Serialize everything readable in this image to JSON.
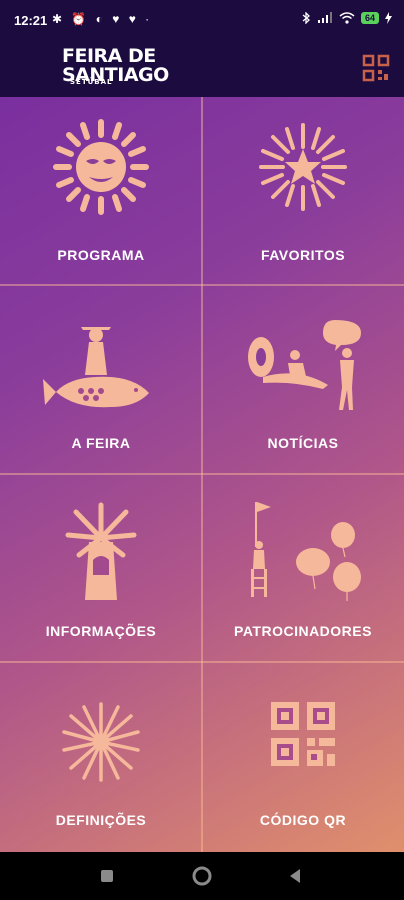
{
  "status_bar": {
    "time": "12:21",
    "left_icons": "✱ ⏰ ◐ ♥ ♥ ·",
    "battery": "64"
  },
  "header": {
    "logo_line1": "FEIRA DE",
    "logo_line2": "SANTIAGO",
    "logo_sub": "SETÚBAL"
  },
  "menu": {
    "programa": "PROGRAMA",
    "favoritos": "FAVORITOS",
    "a_feira": "A FEIRA",
    "noticias": "NOTÍCIAS",
    "informacoes": "INFORMAÇÕES",
    "patrocinadores": "PATROCINADORES",
    "definicoes": "DEFINIÇÕES",
    "codigo_qr": "CÓDIGO QR"
  },
  "colors": {
    "illustration": "#f6b89a",
    "header_bg": "#1c0b3f",
    "gradient_start": "#7a2f9f",
    "gradient_end": "#e08f6c"
  }
}
